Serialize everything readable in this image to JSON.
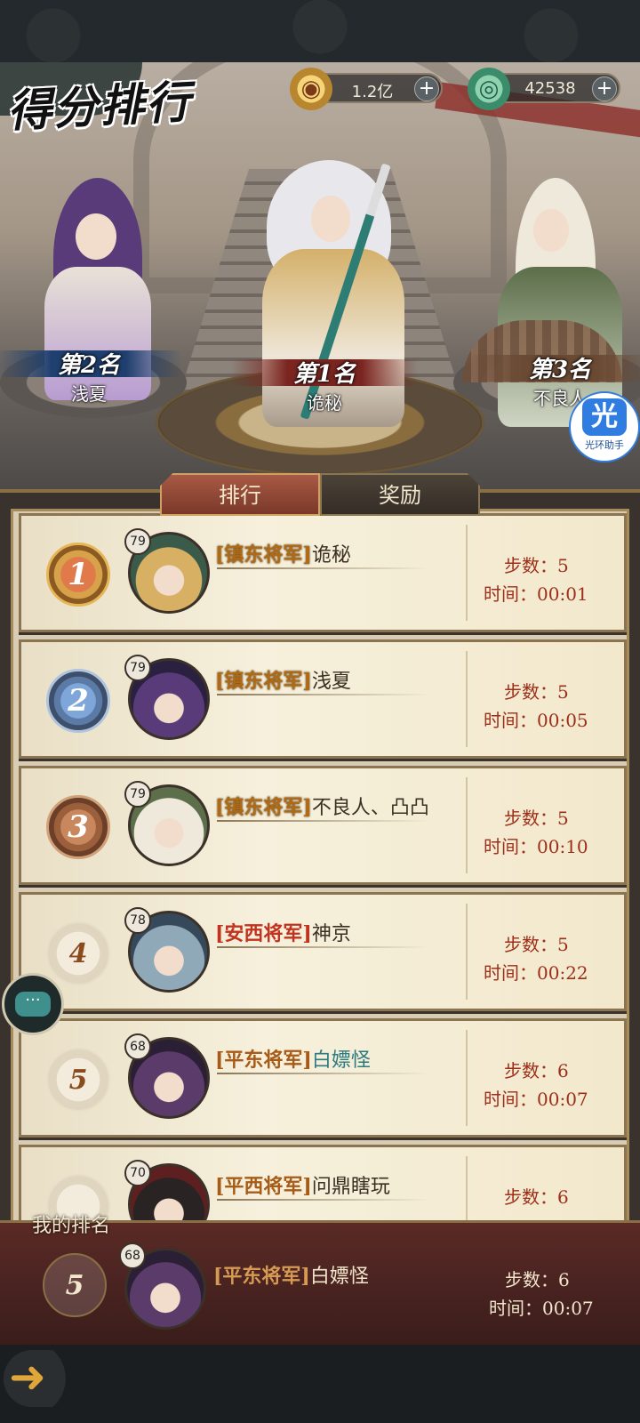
{
  "header": {
    "title": "得分排行",
    "currency_gold": {
      "icon": "gold-coin-icon",
      "value": "1.2亿",
      "add": "+"
    },
    "currency_jade": {
      "icon": "jade-icon",
      "value": "42538",
      "add": "+"
    }
  },
  "podium": {
    "first": {
      "rank_label": "第1名",
      "name": "诡秘"
    },
    "second": {
      "rank_label": "第2名",
      "name": "浅夏"
    },
    "third": {
      "rank_label": "第3名",
      "name": "不良人"
    }
  },
  "helper": {
    "glyph": "光",
    "label": "光环助手"
  },
  "tabs": {
    "rank": "排行",
    "reward": "奖励"
  },
  "rows": [
    {
      "rank": "1",
      "level": "79",
      "title": "[镇东将军]",
      "name": "诡秘",
      "steps_label": "步数：",
      "steps": "5",
      "time_label": "时间：",
      "time": "00:01"
    },
    {
      "rank": "2",
      "level": "79",
      "title": "[镇东将军]",
      "name": "浅夏",
      "steps_label": "步数：",
      "steps": "5",
      "time_label": "时间：",
      "time": "00:05"
    },
    {
      "rank": "3",
      "level": "79",
      "title": "[镇东将军]",
      "name": "不良人、凸凸",
      "steps_label": "步数：",
      "steps": "5",
      "time_label": "时间：",
      "time": "00:10"
    },
    {
      "rank": "4",
      "level": "78",
      "title": "[安西将军]",
      "name": "神京",
      "steps_label": "步数：",
      "steps": "5",
      "time_label": "时间：",
      "time": "00:22"
    },
    {
      "rank": "5",
      "level": "68",
      "title": "[平东将军]",
      "name": "白嫖怪",
      "steps_label": "步数：",
      "steps": "6",
      "time_label": "时间：",
      "time": "00:07"
    },
    {
      "rank": "",
      "level": "70",
      "title": "[平西将军]",
      "name": "问鼎瞎玩",
      "steps_label": "步数：",
      "steps": "6",
      "time_label": "",
      "time": ""
    }
  ],
  "my_rank": {
    "label": "我的排名",
    "rank": "5",
    "level": "68",
    "title": "[平东将军]",
    "name": "白嫖怪",
    "steps_label": "步数：",
    "steps": "6",
    "time_label": "时间：",
    "time": "00:07"
  },
  "chat": {
    "glyph": "···"
  },
  "back": {
    "glyph": "➜"
  }
}
